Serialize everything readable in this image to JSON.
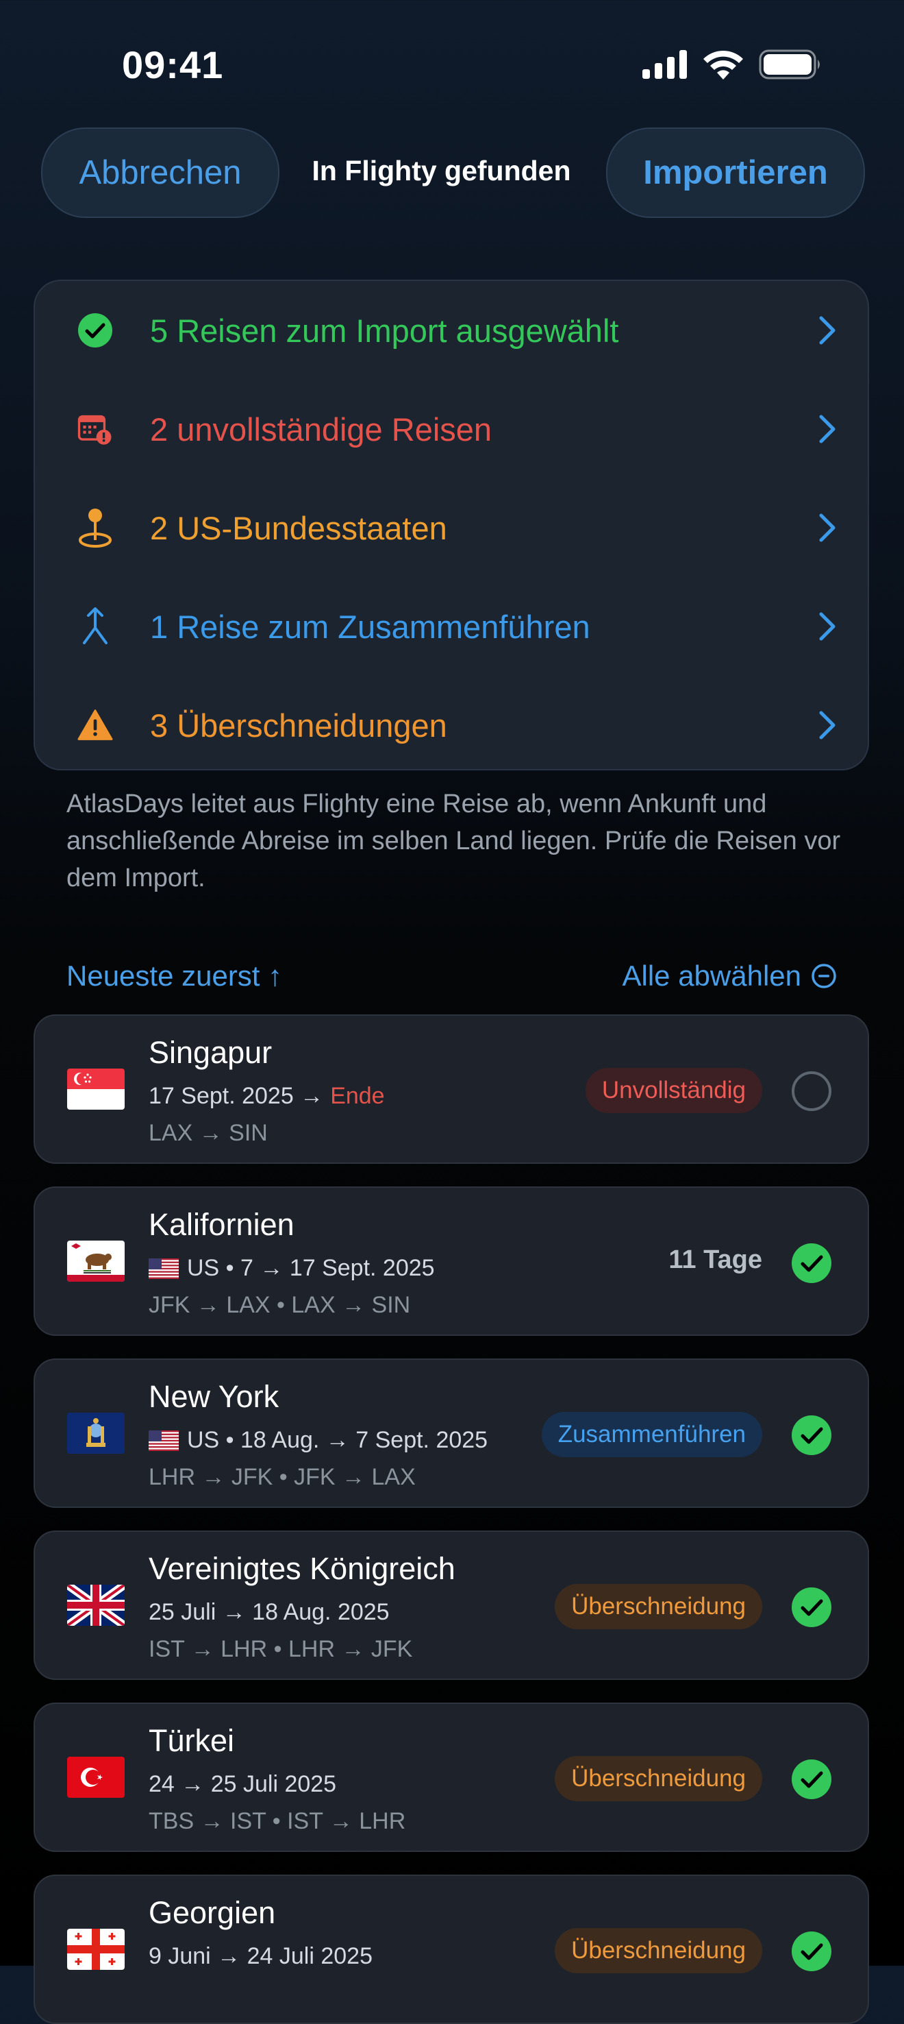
{
  "status_bar": {
    "time": "09:41"
  },
  "header": {
    "cancel_label": "Abbrechen",
    "title": "In Flighty gefunden",
    "import_label": "Importieren"
  },
  "summary": {
    "rows": [
      {
        "label": "5 Reisen zum Import ausgewählt",
        "color": "#34c759",
        "icon": "checkmark-circle-icon"
      },
      {
        "label": "2 unvollständige Reisen",
        "color": "#e5534b",
        "icon": "calendar-alert-icon"
      },
      {
        "label": "2 US-Bundesstaaten",
        "color": "#f0a030",
        "icon": "map-pin-icon"
      },
      {
        "label": "1 Reise zum Zusammenführen",
        "color": "#3b9bea",
        "icon": "merge-icon"
      },
      {
        "label": "3 Überschneidungen",
        "color": "#f0952f",
        "icon": "warning-triangle-icon"
      }
    ],
    "note": "AtlasDays leitet aus Flighty eine Reise ab, wenn Ankunft und anschließende Abreise im selben Land liegen. Prüfe die Reisen vor dem Import."
  },
  "sort": {
    "left_label": "Neueste zuerst ↑",
    "right_label": "Alle abwählen"
  },
  "trips": [
    {
      "name": "Singapur",
      "dates": "17 Sept. 2025 →",
      "end_label": "Ende",
      "route": "LAX → SIN",
      "badge": "Unvollständig",
      "selected": false,
      "flag": "singapore-flag-icon"
    },
    {
      "name": "Kalifornien",
      "dates": "US • 7 → 17 Sept. 2025",
      "route": "JFK → LAX • LAX → SIN",
      "duration": "11 Tage",
      "selected": true,
      "flag": "california-flag-icon"
    },
    {
      "name": "New York",
      "dates": "US • 18 Aug. → 7 Sept. 2025",
      "route": "LHR → JFK • JFK → LAX",
      "badge": "Zusammenführen",
      "selected": true,
      "flag": "new-york-flag-icon"
    },
    {
      "name": "Vereinigtes Königreich",
      "dates": "25 Juli → 18 Aug. 2025",
      "route": "IST → LHR • LHR → JFK",
      "badge": "Überschneidung",
      "selected": true,
      "flag": "uk-flag-icon"
    },
    {
      "name": "Türkei",
      "dates": "24 → 25 Juli 2025",
      "route": "TBS → IST • IST → LHR",
      "badge": "Überschneidung",
      "selected": true,
      "flag": "turkey-flag-icon"
    },
    {
      "name": "Georgien",
      "dates": "9 Juni → 24 Juli 2025",
      "route": "",
      "badge": "Überschneidung",
      "selected": true,
      "flag": "georgia-flag-icon"
    }
  ]
}
